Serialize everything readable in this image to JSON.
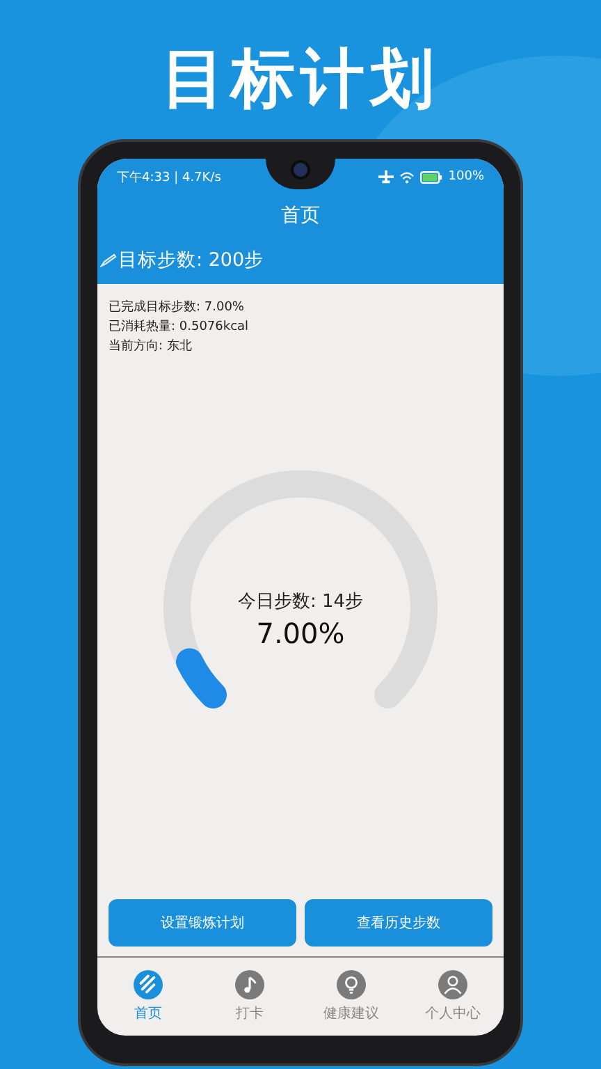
{
  "headline": "目标计划",
  "status_bar": {
    "time": "下午4:33 | 4.7K/s",
    "battery": "100%"
  },
  "title": "首页",
  "goal": "目标步数: 200步",
  "stats": [
    "已完成目标步数: 7.00%",
    "已消耗热量: 0.5076kcal",
    "当前方向: 东北"
  ],
  "gauge": {
    "caption": "今日步数: 14步",
    "percent": "7.00%",
    "level": 0.07
  },
  "buttons": [
    "设置锻炼计划",
    "查看历史步数"
  ],
  "tabs": [
    {
      "label": "首页",
      "selected": true
    },
    {
      "label": "打卡",
      "selected": false
    },
    {
      "label": "健康建议",
      "selected": false
    },
    {
      "label": "个人中心",
      "selected": false
    }
  ]
}
